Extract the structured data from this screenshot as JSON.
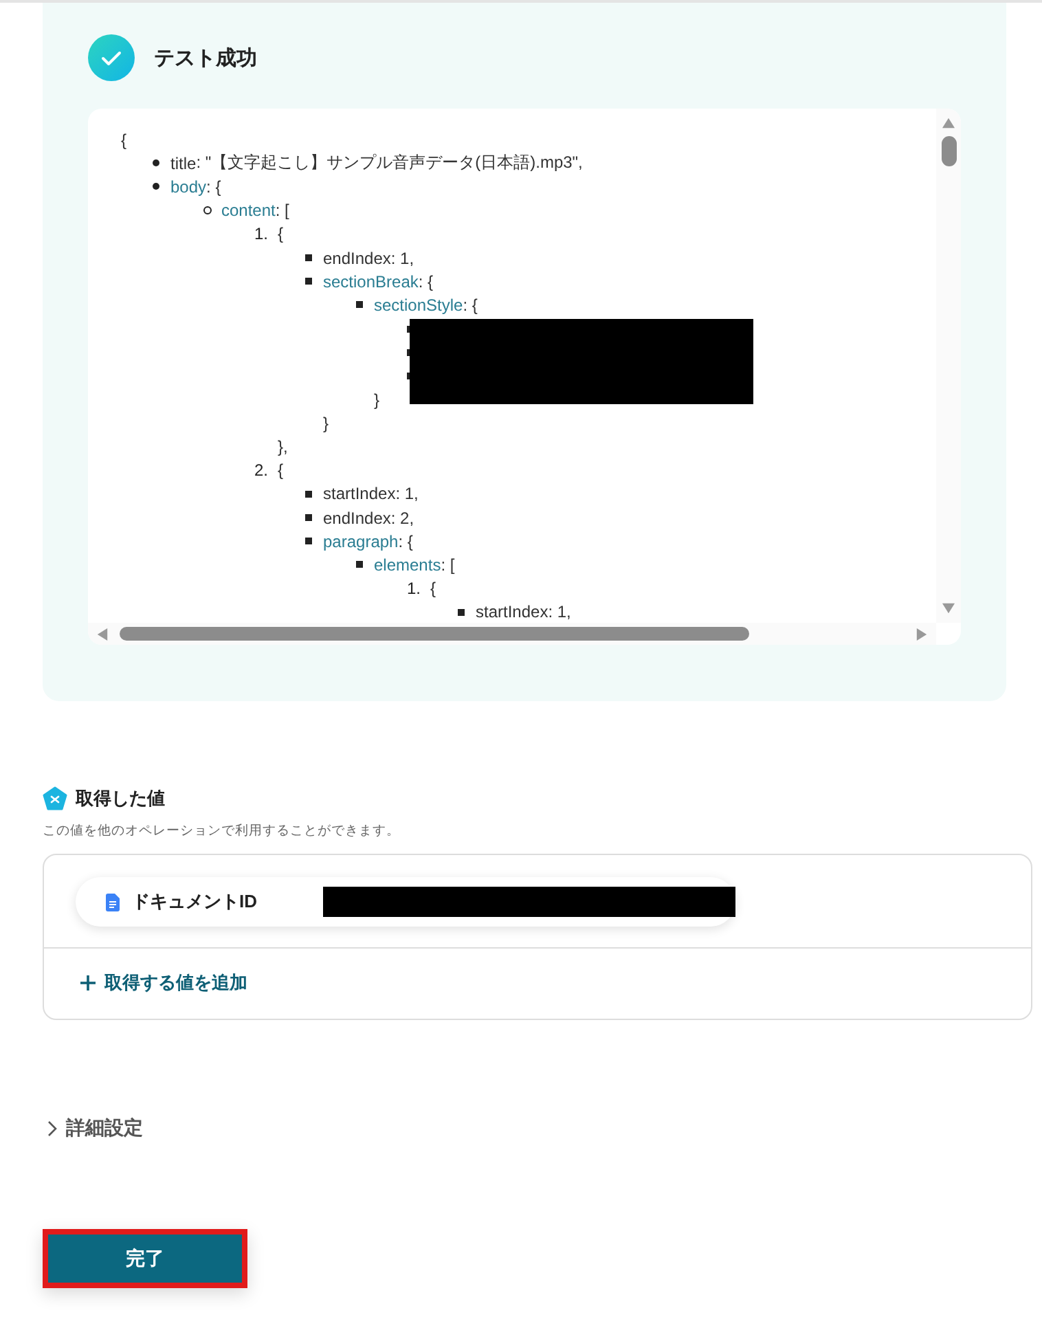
{
  "result": {
    "title": "テスト成功",
    "tree": {
      "text": "{",
      "children": [
        {
          "kind": "disc",
          "key": "title",
          "text": ": \"【文字起こし】サンプル音声データ(日本語).mp3\","
        },
        {
          "kind": "disc",
          "key": "body",
          "link": true,
          "text": ": {",
          "children": [
            {
              "kind": "circle",
              "key": "content",
              "link": true,
              "text": ": [",
              "children": [
                {
                  "number": "1.",
                  "text": "{",
                  "close": "},",
                  "children": [
                    {
                      "kind": "square",
                      "key": "endIndex",
                      "text": ": 1,"
                    },
                    {
                      "kind": "square",
                      "key": "sectionBreak",
                      "link": true,
                      "text": ": {",
                      "close": "}",
                      "children": [
                        {
                          "kind": "square",
                          "key": "sectionStyle",
                          "link": true,
                          "text": ": {",
                          "close": "}",
                          "redacted": true,
                          "children": [
                            {
                              "kind": "square"
                            },
                            {
                              "kind": "square"
                            },
                            {
                              "kind": "square"
                            }
                          ]
                        }
                      ]
                    }
                  ]
                },
                {
                  "number": "2.",
                  "text": "{",
                  "children": [
                    {
                      "kind": "square",
                      "key": "startIndex",
                      "text": ": 1,"
                    },
                    {
                      "kind": "square",
                      "key": "endIndex",
                      "text": ": 2,"
                    },
                    {
                      "kind": "square",
                      "key": "paragraph",
                      "link": true,
                      "text": ": {",
                      "children": [
                        {
                          "kind": "square",
                          "key": "elements",
                          "link": true,
                          "text": ": [",
                          "children": [
                            {
                              "number": "1.",
                              "text": "{",
                              "children": [
                                {
                                  "kind": "square",
                                  "key": "startIndex",
                                  "text": ": 1,"
                                }
                              ]
                            }
                          ]
                        }
                      ]
                    }
                  ]
                }
              ]
            }
          ]
        }
      ]
    }
  },
  "values": {
    "title": "取得した値",
    "description": "この値を他のオペレーションで利用することができます。",
    "items": [
      {
        "label": "ドキュメントID",
        "value_redacted": true
      }
    ],
    "add_link": "取得する値を追加"
  },
  "advanced": {
    "label": "詳細設定",
    "expanded": false
  },
  "done_button": {
    "label": "完了",
    "highlighted": true
  }
}
